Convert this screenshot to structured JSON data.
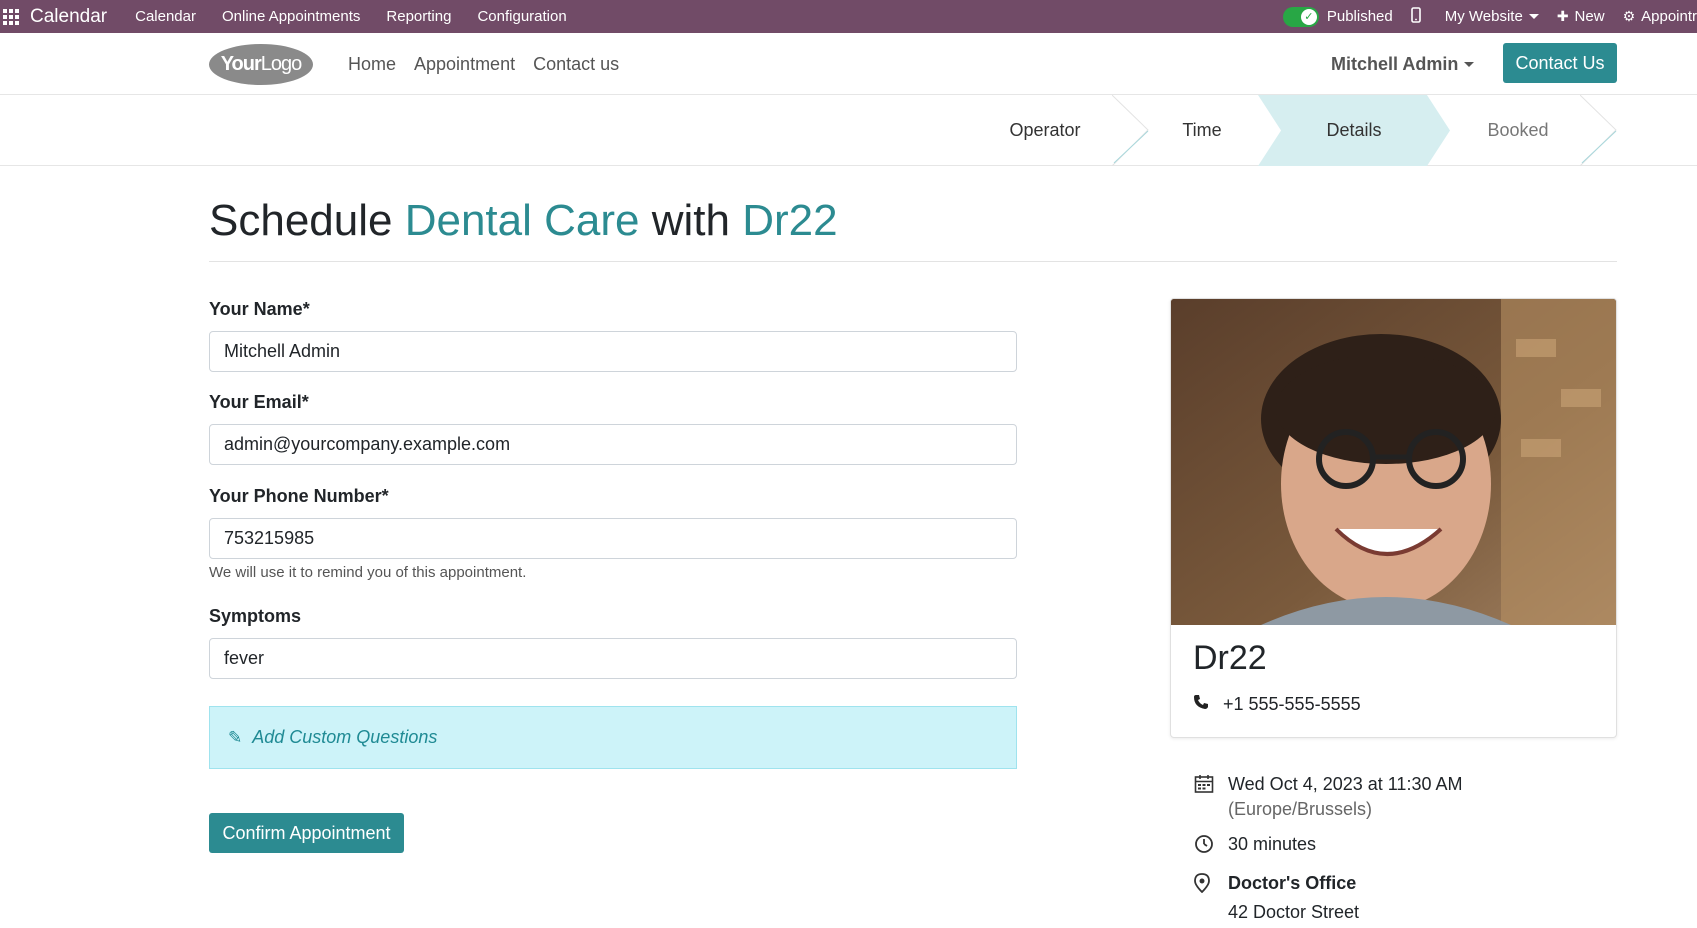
{
  "topbar": {
    "app_name": "Calendar",
    "menus": [
      "Calendar",
      "Online Appointments",
      "Reporting",
      "Configuration"
    ],
    "published_label": "Published",
    "website_label": "My Website",
    "new_label": "New",
    "appoint_label": "Appointr"
  },
  "header": {
    "logo_text_bold": "Your",
    "logo_text_thin": "Logo",
    "nav": [
      "Home",
      "Appointment",
      "Contact us"
    ],
    "user": "Mitchell Admin",
    "contact_button": "Contact Us"
  },
  "steps": [
    {
      "label": "Operator",
      "state": "done"
    },
    {
      "label": "Time",
      "state": "done"
    },
    {
      "label": "Details",
      "state": "active"
    },
    {
      "label": "Booked",
      "state": "pending"
    }
  ],
  "title": {
    "prefix": "Schedule ",
    "service": "Dental Care",
    "middle": " with ",
    "staff": "Dr22"
  },
  "form": {
    "name_label": "Your Name*",
    "name_value": "Mitchell Admin",
    "email_label": "Your Email*",
    "email_value": "admin@yourcompany.example.com",
    "phone_label": "Your Phone Number*",
    "phone_value": "753215985",
    "phone_help": "We will use it to remind you of this appointment.",
    "symptoms_label": "Symptoms",
    "symptoms_value": "fever",
    "custom_questions": "Add Custom Questions",
    "confirm_button": "Confirm Appointment"
  },
  "card": {
    "name": "Dr22",
    "phone": "+1 555-555-5555"
  },
  "details": {
    "datetime": "Wed Oct 4, 2023 at 11:30 AM",
    "timezone": "(Europe/Brussels)",
    "duration": "30 minutes",
    "location_name": "Doctor's Office",
    "location_address": "42 Doctor Street"
  },
  "colors": {
    "topbar": "#714b67",
    "accent": "#2c8b91",
    "step_active": "#d6eef0",
    "info_bg": "#cdf3f9"
  }
}
